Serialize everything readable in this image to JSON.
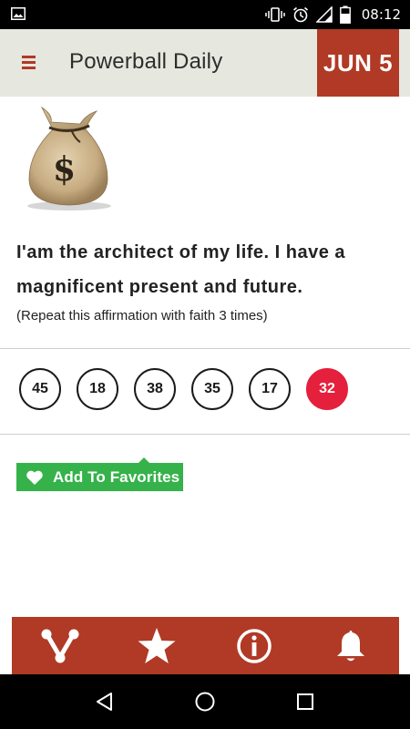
{
  "status_bar": {
    "time": "08:12"
  },
  "header": {
    "title": "Powerball Daily",
    "date": "JUN 5"
  },
  "affirmation": {
    "text": "I'am the architect of my life. I have a magnificent present and future.",
    "hint": "(Repeat this affirmation with faith 3 times)"
  },
  "numbers": {
    "white_balls": [
      "45",
      "18",
      "38",
      "35",
      "17"
    ],
    "powerball": "32"
  },
  "favorites": {
    "label": "Add To Favorites"
  },
  "colors": {
    "accent": "#b03a25",
    "powerball": "#e4203c",
    "favorite": "#35b24a",
    "header_bg": "#e6e7df"
  },
  "bottom_nav": {
    "icons": [
      "share-icon",
      "star-icon",
      "info-icon",
      "bell-icon"
    ]
  }
}
